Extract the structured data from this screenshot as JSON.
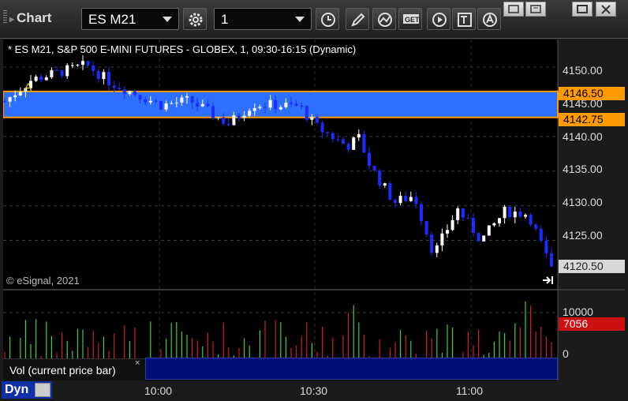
{
  "window": {
    "title": "Chart",
    "symbol_value": "ES M21",
    "interval_value": "1"
  },
  "toolbar": {
    "icons": [
      "settings-icon",
      "clock-icon",
      "pencil-icon",
      "study-icon",
      "get-icon",
      "play-icon",
      "text-icon",
      "alert-icon"
    ],
    "get_label": "GET"
  },
  "chart": {
    "pane_title": "* ES M21, S&P 500 E-MINI FUTURES - GLOBEX, 1, 09:30-16:15 (Dynamic)",
    "marker_label": "A",
    "copyright": "© eSignal, 2021",
    "price_levels": [
      "4150.00",
      "4145.00",
      "4140.00",
      "4135.00",
      "4130.00",
      "4125.00"
    ],
    "zone_upper_label": "4146.50",
    "zone_lower_label": "4142.75",
    "last_price_label": "4120.50",
    "volume_axis_labels": [
      "10000",
      "0"
    ],
    "volume_last_label": "7056",
    "volume_study_label": "Vol (current price bar)",
    "volume_close": "×",
    "mode_label": "Dyn",
    "time_labels": [
      "10:00",
      "10:30",
      "11:00"
    ],
    "colors": {
      "background": "#000000",
      "up_bar": "#ffffff",
      "down_bar": "#1a2cff",
      "zone_fill": "#2f6fff",
      "zone_border": "#ff9a00",
      "volume_up": "#3fcf3f",
      "volume_down": "#cc2222"
    }
  },
  "chart_data": {
    "type": "candlestick",
    "ylim": [
      4118,
      4154
    ],
    "yticks": [
      4125,
      4130,
      4135,
      4140,
      4145,
      4150
    ],
    "zone": [
      4142.75,
      4146.5
    ],
    "last_price": 4120.5,
    "x": [
      "10:00",
      "10:30",
      "11:00"
    ],
    "y_close": [
      4148.5,
      4142.25,
      4120.5
    ],
    "volume_last": 7056,
    "volume_ylim": [
      0,
      13000
    ]
  }
}
